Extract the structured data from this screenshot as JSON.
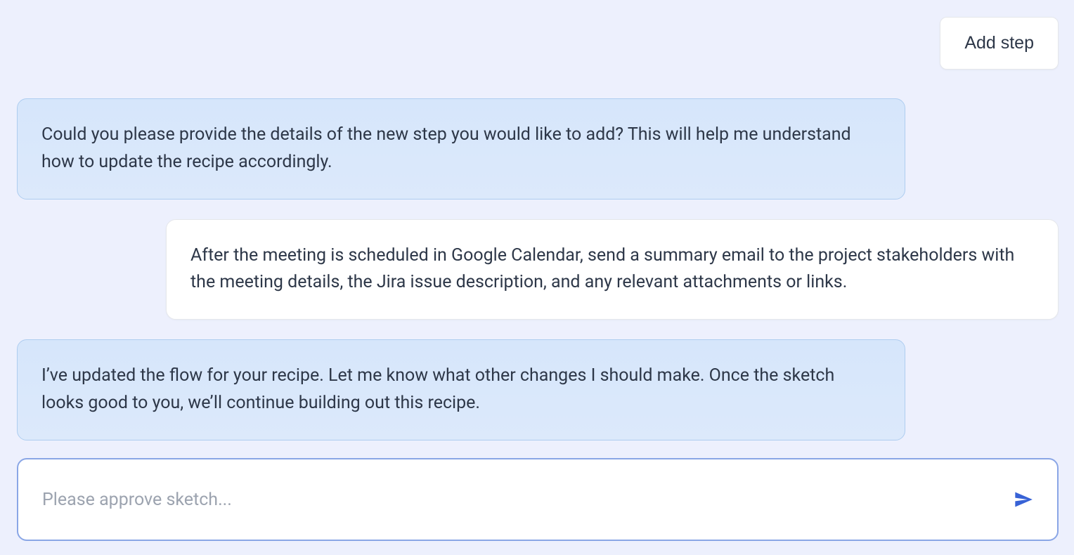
{
  "header": {
    "add_step_label": "Add step"
  },
  "messages": [
    {
      "role": "assistant",
      "text": "Could you please provide the details of the new step you would like to add? This will help me understand how to update the recipe accordingly."
    },
    {
      "role": "user",
      "text": "After the meeting is scheduled in Google Calendar, send a summary email to the project stakeholders with the meeting details, the Jira issue description, and any relevant attachments or links."
    },
    {
      "role": "assistant",
      "text": "I’ve updated the flow for your recipe. Let me know what other changes I should make. Once the sketch looks good to you, we’ll continue building out this recipe."
    }
  ],
  "input": {
    "placeholder": "Please approve sketch..."
  }
}
